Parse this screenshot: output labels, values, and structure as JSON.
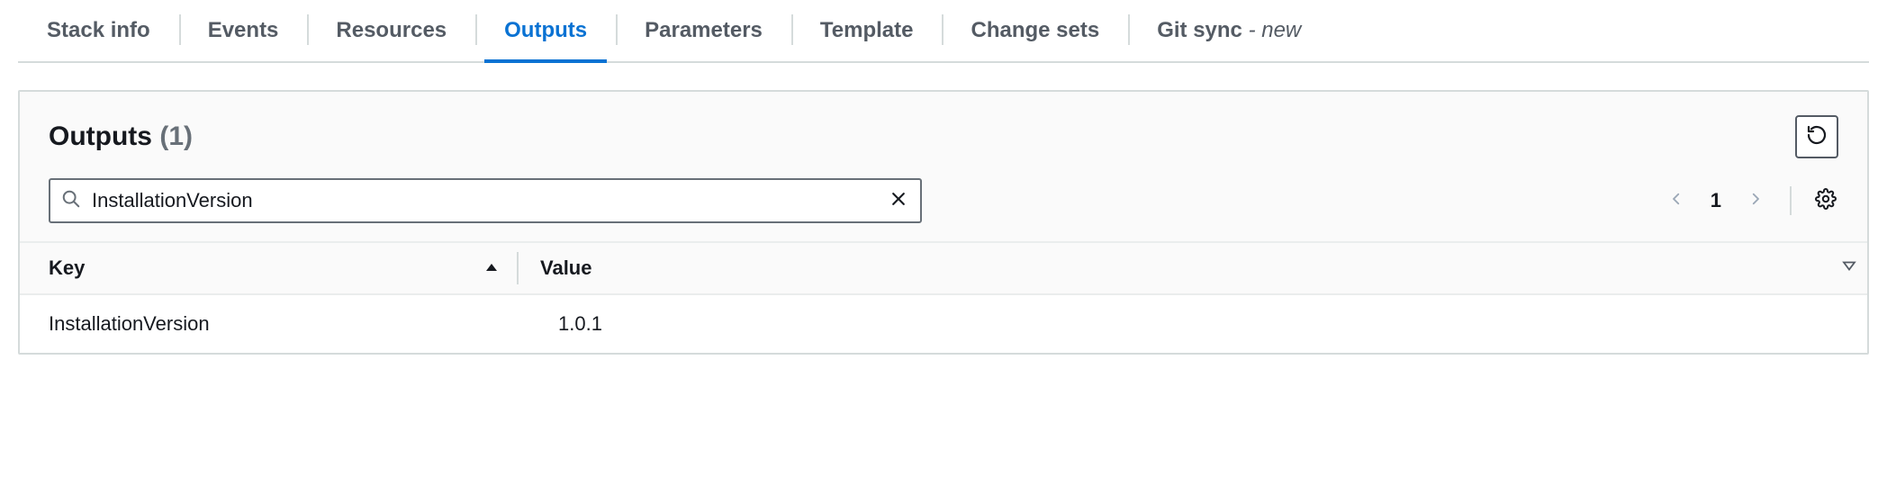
{
  "tabs": [
    {
      "label": "Stack info",
      "active": false
    },
    {
      "label": "Events",
      "active": false
    },
    {
      "label": "Resources",
      "active": false
    },
    {
      "label": "Outputs",
      "active": true
    },
    {
      "label": "Parameters",
      "active": false
    },
    {
      "label": "Template",
      "active": false
    },
    {
      "label": "Change sets",
      "active": false
    },
    {
      "label": "Git sync",
      "suffix": " - new",
      "active": false
    }
  ],
  "panel": {
    "title": "Outputs",
    "count": "(1)"
  },
  "search": {
    "value": "InstallationVersion",
    "placeholder": ""
  },
  "pagination": {
    "current": "1"
  },
  "columns": {
    "key": "Key",
    "value": "Value"
  },
  "rows": [
    {
      "key": "InstallationVersion",
      "value": "1.0.1"
    }
  ]
}
